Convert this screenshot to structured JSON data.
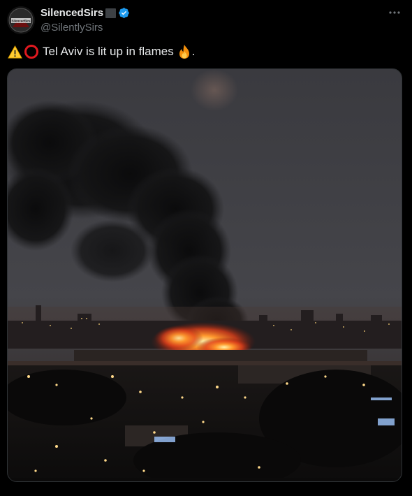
{
  "author": {
    "display_name": "SilencedSirs",
    "handle": "@SilentlySirs",
    "avatar_text": "SilencedSirs",
    "verified_icon": "verified-badge-icon",
    "name_emoji": "black-square-emoji"
  },
  "post": {
    "text": "Tel Aviv is lit up in flames",
    "trailing_punctuation": ".",
    "leading_emojis": [
      "warning-emoji",
      "red-circle-emoji"
    ],
    "trailing_emoji": "fire-emoji"
  },
  "colors": {
    "background": "#000000",
    "text": "#e7e9ea",
    "secondary_text": "#71767b",
    "verified": "#1d9bf0"
  }
}
